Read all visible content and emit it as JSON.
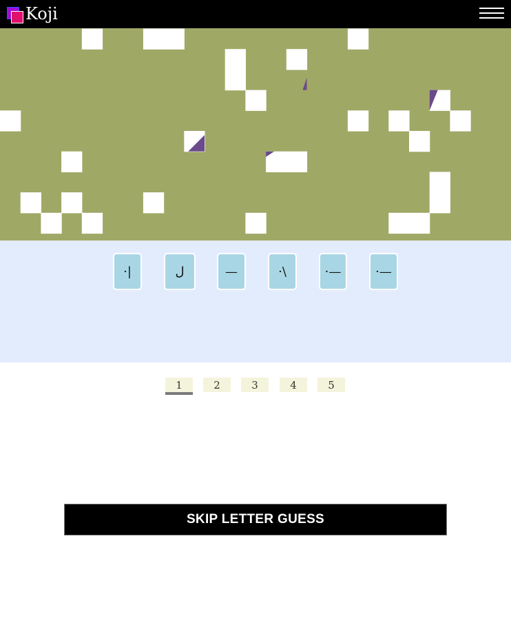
{
  "app": {
    "brand": "Koji"
  },
  "colors": {
    "board_bg": "#a0a866",
    "revealed_cell": "#ffffff",
    "hint_triangle": "#6a4a8c",
    "tray_bg": "#e3ecfd",
    "tile_bg": "#a8d6e4",
    "tab_bg": "#f4f4dc"
  },
  "board": {
    "grid_cols": 25,
    "grid_rows": 10,
    "revealed_cells": [
      [
        4,
        0
      ],
      [
        7,
        0
      ],
      [
        8,
        0
      ],
      [
        17,
        0
      ],
      [
        11,
        1
      ],
      [
        14,
        1
      ],
      [
        11,
        2
      ],
      [
        12,
        3
      ],
      [
        21,
        3
      ],
      [
        0,
        4
      ],
      [
        17,
        4
      ],
      [
        19,
        4
      ],
      [
        22,
        4
      ],
      [
        9,
        5
      ],
      [
        20,
        5
      ],
      [
        3,
        6
      ],
      [
        13,
        6
      ],
      [
        14,
        6
      ],
      [
        21,
        7
      ],
      [
        1,
        8
      ],
      [
        3,
        8
      ],
      [
        7,
        8
      ],
      [
        21,
        8
      ],
      [
        2,
        9
      ],
      [
        4,
        9
      ],
      [
        12,
        9
      ],
      [
        19,
        9
      ],
      [
        20,
        9
      ]
    ],
    "hint_cells": [
      {
        "col": 14,
        "row": 2,
        "corner": "bottom-right-edge"
      },
      {
        "col": 21,
        "row": 3,
        "corner": "left"
      },
      {
        "col": 9,
        "row": 5,
        "corner": "bottom-right"
      },
      {
        "col": 13,
        "row": 6,
        "corner": "top-left"
      }
    ]
  },
  "tiles": [
    {
      "glyph": "·|"
    },
    {
      "glyph": "ل"
    },
    {
      "glyph": "—"
    },
    {
      "glyph": "·\\"
    },
    {
      "glyph": "·—"
    },
    {
      "glyph": "·—"
    }
  ],
  "tabs": [
    "1",
    "2",
    "3",
    "4",
    "5"
  ],
  "active_tab": "1",
  "actions": {
    "skip_label": "SKIP LETTER GUESS"
  }
}
